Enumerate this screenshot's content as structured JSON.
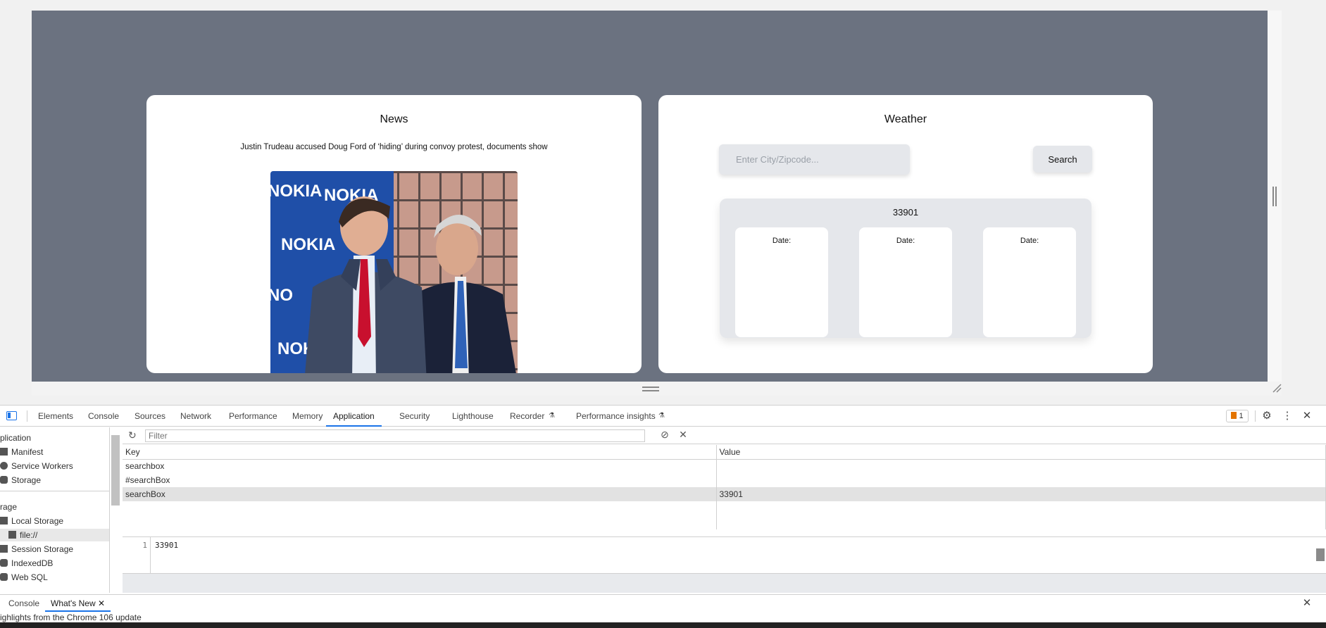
{
  "news": {
    "title": "News",
    "headline": "Justin Trudeau accused Doug Ford of ‘hiding’ during convoy protest, documents show",
    "photo_banner_text": [
      "NOKIA",
      "NOKIA",
      "NOKIA",
      "NO",
      "NOKIA"
    ]
  },
  "weather": {
    "title": "Weather",
    "search_placeholder": "Enter City/Zipcode...",
    "search_button": "Search",
    "location": "33901",
    "days": [
      {
        "date_label": "Date:"
      },
      {
        "date_label": "Date:"
      },
      {
        "date_label": "Date:"
      }
    ]
  },
  "devtools": {
    "tabs": [
      "Elements",
      "Console",
      "Sources",
      "Network",
      "Performance",
      "Memory",
      "Application",
      "Security",
      "Lighthouse",
      "Recorder",
      "Performance insights"
    ],
    "active_tab": "Application",
    "issues_count": "1",
    "sidebar": {
      "application_header": "plication",
      "application_items": [
        "Manifest",
        "Service Workers",
        "Storage"
      ],
      "storage_header": "rage",
      "storage_items": [
        "Local Storage",
        "file://",
        "Session Storage",
        "IndexedDB",
        "Web SQL"
      ]
    },
    "filter_placeholder": "Filter",
    "table": {
      "headers": {
        "key": "Key",
        "value": "Value"
      },
      "rows": [
        {
          "key": "searchbox",
          "value": ""
        },
        {
          "key": "#searchBox",
          "value": ""
        },
        {
          "key": "searchBox",
          "value": "33901"
        }
      ]
    },
    "preview": {
      "line_number": "1",
      "value": "33901"
    },
    "drawer": {
      "tabs": [
        "Console",
        "What's New"
      ],
      "active_tab": "What's New",
      "strip_text": "ighlights from the Chrome 106 update"
    }
  },
  "colors": {
    "page_background": "#6b7280",
    "card_background": "#ffffff",
    "panel_background": "#e5e7eb",
    "devtools_accent": "#1a73e8"
  }
}
